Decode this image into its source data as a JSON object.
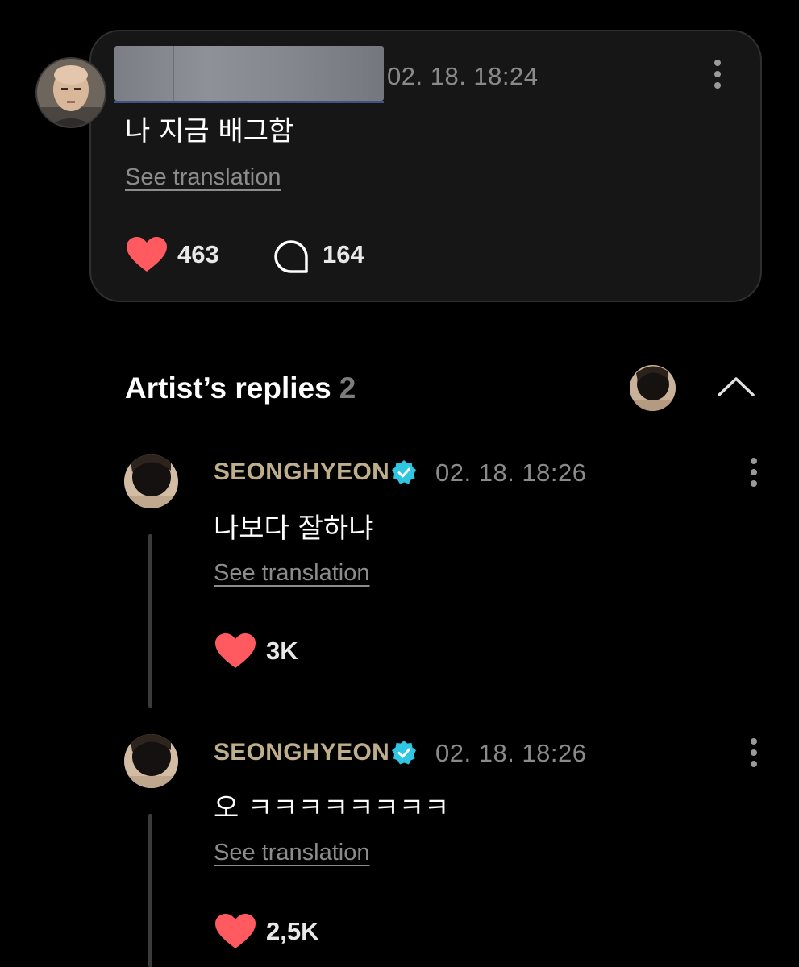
{
  "post": {
    "timestamp": "02. 18. 18:24",
    "text": "나 지금 배그함",
    "see_translation": "See translation",
    "like_count": "463",
    "comment_count": "164"
  },
  "artist_replies": {
    "title": "Artist’s replies",
    "count": "2"
  },
  "replies": [
    {
      "author": "SEONGHYEON",
      "timestamp": "02. 18. 18:26",
      "text": "나보다 잘하냐",
      "see_translation": "See translation",
      "like_count": "3K"
    },
    {
      "author": "SEONGHYEON",
      "timestamp": "02. 18. 18:26",
      "text": "오 ㅋㅋㅋㅋㅋㅋㅋㅋ",
      "see_translation": "See translation",
      "like_count": "2,5K"
    }
  ],
  "colors": {
    "background": "#000000",
    "card": "#161616",
    "author": "#bfae8c",
    "heart": "#ff5a5f",
    "verified": "#2ec6e0",
    "muted": "#8a8a8a"
  },
  "icons": {
    "like": "heart-icon",
    "comment": "comment-bubble-icon",
    "more": "more-vertical-icon",
    "collapse": "chevron-up-icon",
    "verified": "verified-badge-icon"
  }
}
